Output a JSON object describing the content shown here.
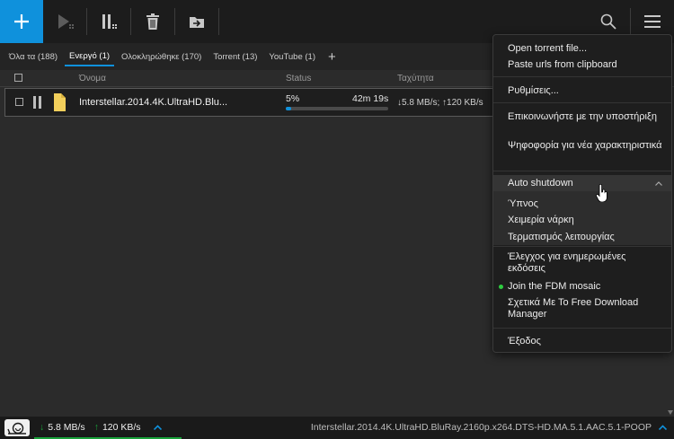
{
  "toolbar": {
    "buttons": [
      "add-icon",
      "play-icon",
      "pause-icon",
      "trash-icon",
      "move-icon"
    ],
    "right_buttons": [
      "search-icon",
      "menu-icon"
    ],
    "accent": "#0f91dc"
  },
  "tabs": [
    {
      "label": "Όλα τα (188)",
      "active": false
    },
    {
      "label": "Ενεργό (1)",
      "active": true
    },
    {
      "label": "Ολοκληρώθηκε (170)",
      "active": false
    },
    {
      "label": "Torrent (13)",
      "active": false
    },
    {
      "label": "YouTube (1)",
      "active": false
    }
  ],
  "tab_add_label": "+",
  "table": {
    "columns": {
      "name": "Όνομα",
      "status": "Status",
      "speed": "Ταχύτητα"
    },
    "rows": [
      {
        "name": "Interstellar.2014.4K.UltraHD.BluRay.2160p.x264.DTS-HD.MA.5.1.AAC.5.1-POOP",
        "name_display": "Interstellar.2014.4K.UltraHD.Blu...",
        "percent": "5%",
        "progress": 0.05,
        "eta": "42m 19s",
        "speed": "↓5.8 MB/s; ↑120 KB/s"
      }
    ]
  },
  "statusbar": {
    "down": "5.8 MB/s",
    "up": "120 KB/s",
    "current_file": "Interstellar.2014.4K.UltraHD.BluRay.2160p.x264.DTS-HD.MA.5.1.AAC.5.1-POOP",
    "down_arrow": "↓",
    "up_arrow": "↑"
  },
  "menu": {
    "open_torrent": "Open torrent file...",
    "paste_urls": "Paste urls from clipboard",
    "settings": "Ρυθμίσεις...",
    "contact_support": "Επικοινωνήστε με την υποστήριξη",
    "vote_features": "Ψηφοφορία για νέα χαρακτηριστικά",
    "auto_shutdown": "Auto shutdown",
    "sleep": "Ύπνος",
    "hibernate": "Χειμερία νάρκη",
    "shutdown": "Τερματισμός λειτουργίας",
    "check_updates": "Έλεγχος για ενημερωμένες εκδόσεις",
    "join_mosaic": "Join the FDM mosaic",
    "about": "Σχετικά Με Το Free Download Manager",
    "exit": "Έξοδος",
    "mosaic_dot_color": "#2ecc40"
  }
}
